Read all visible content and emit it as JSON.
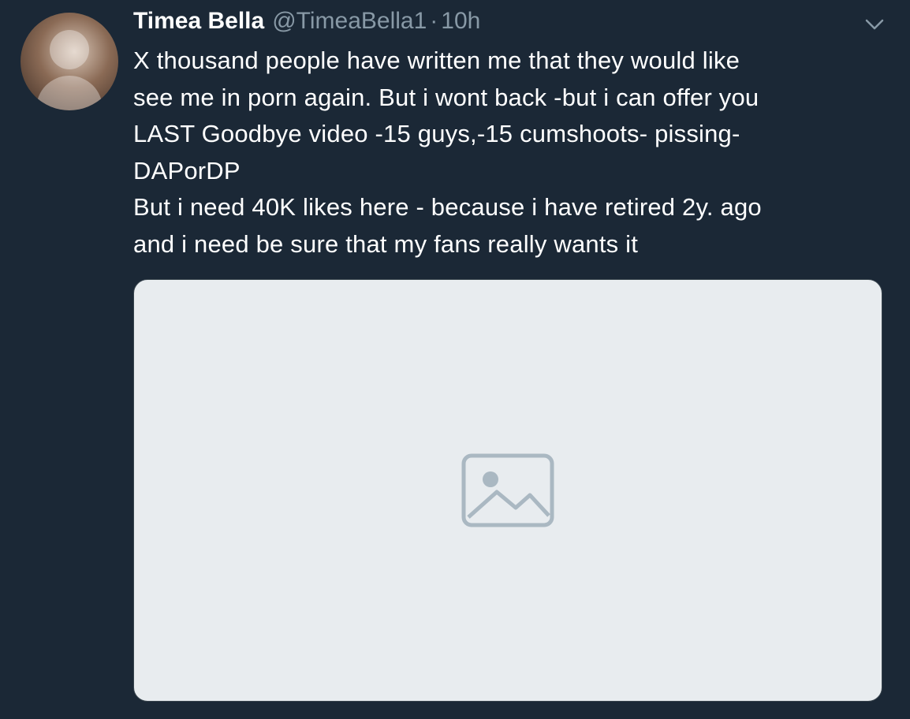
{
  "tweet": {
    "display_name": "Timea Bella",
    "handle": "@TimeaBella1",
    "separator": "·",
    "time": "10h",
    "text": "X thousand people have written me that they would like\nsee me in porn again. But i wont back -but i can offer you\nLAST Goodbye video -15 guys,-15 cumshoots- pissing-\nDAPorDP\nBut i need 40K likes here - because i have retired 2y. ago\nand i need be sure that my fans really wants it"
  },
  "icons": {
    "menu": "chevron-down-icon",
    "avatar": "avatar-placeholder",
    "media": "image-placeholder-icon"
  },
  "colors": {
    "background": "#1b2836",
    "secondary_text": "#8899a6",
    "primary_text": "#ffffff"
  }
}
